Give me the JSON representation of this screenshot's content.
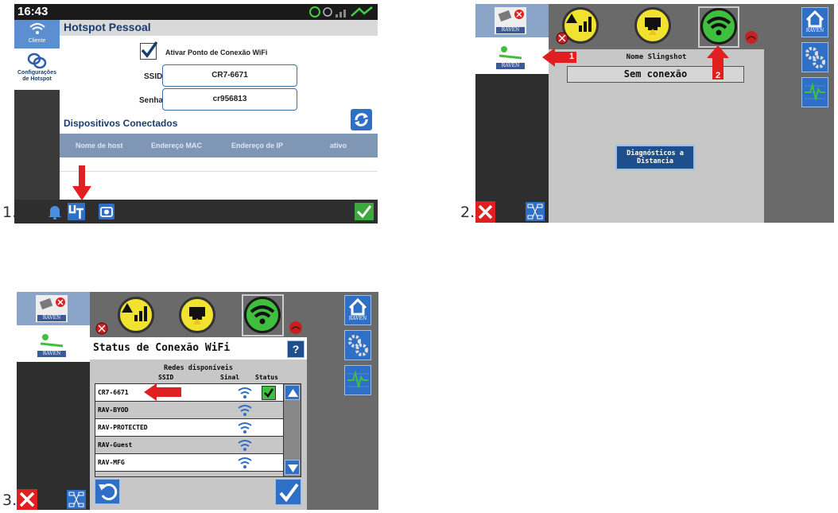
{
  "labels": {
    "step1": "1.",
    "step2": "2.",
    "step3": "3."
  },
  "panel1": {
    "time": "16:43",
    "title": "Hotspot Pessoal",
    "sidebar": {
      "client": "Cliente",
      "config": "Configurações de Hotspot"
    },
    "checkbox_label": "Ativar Ponto de Conexão WiFi",
    "ssid_label": "SSID",
    "ssid_value": "CR7-6671",
    "senha_label": "Senha",
    "senha_value": "cr956813",
    "connected_title": "Dispositivos Conectados",
    "columns": [
      "Nome de host",
      "Endereço MAC",
      "Endereço de IP",
      "ativo"
    ]
  },
  "panel2": {
    "brand": "RAVEN",
    "slingshot_label": "Nome Slingshot",
    "status_value": "Sem conexão",
    "diag_button": "Diagnósticos a Distancia",
    "arrow1": "1",
    "arrow2": "2"
  },
  "panel3": {
    "brand": "RAVEN",
    "title": "Status de Conexão WiFi",
    "help": "?",
    "networks_title": "Redes disponíveis",
    "columns": {
      "ssid": "SSID",
      "signal": "Sinal",
      "status": "Status"
    },
    "networks": [
      "CR7-6671",
      "RAV-BYOD",
      "RAV-PROTECTED",
      "RAV-Guest",
      "RAV-MFG"
    ]
  },
  "colors": {
    "accent": "#2f6fc6",
    "warning": "#f2e230",
    "green": "#3ec03e",
    "red": "#e02020"
  }
}
